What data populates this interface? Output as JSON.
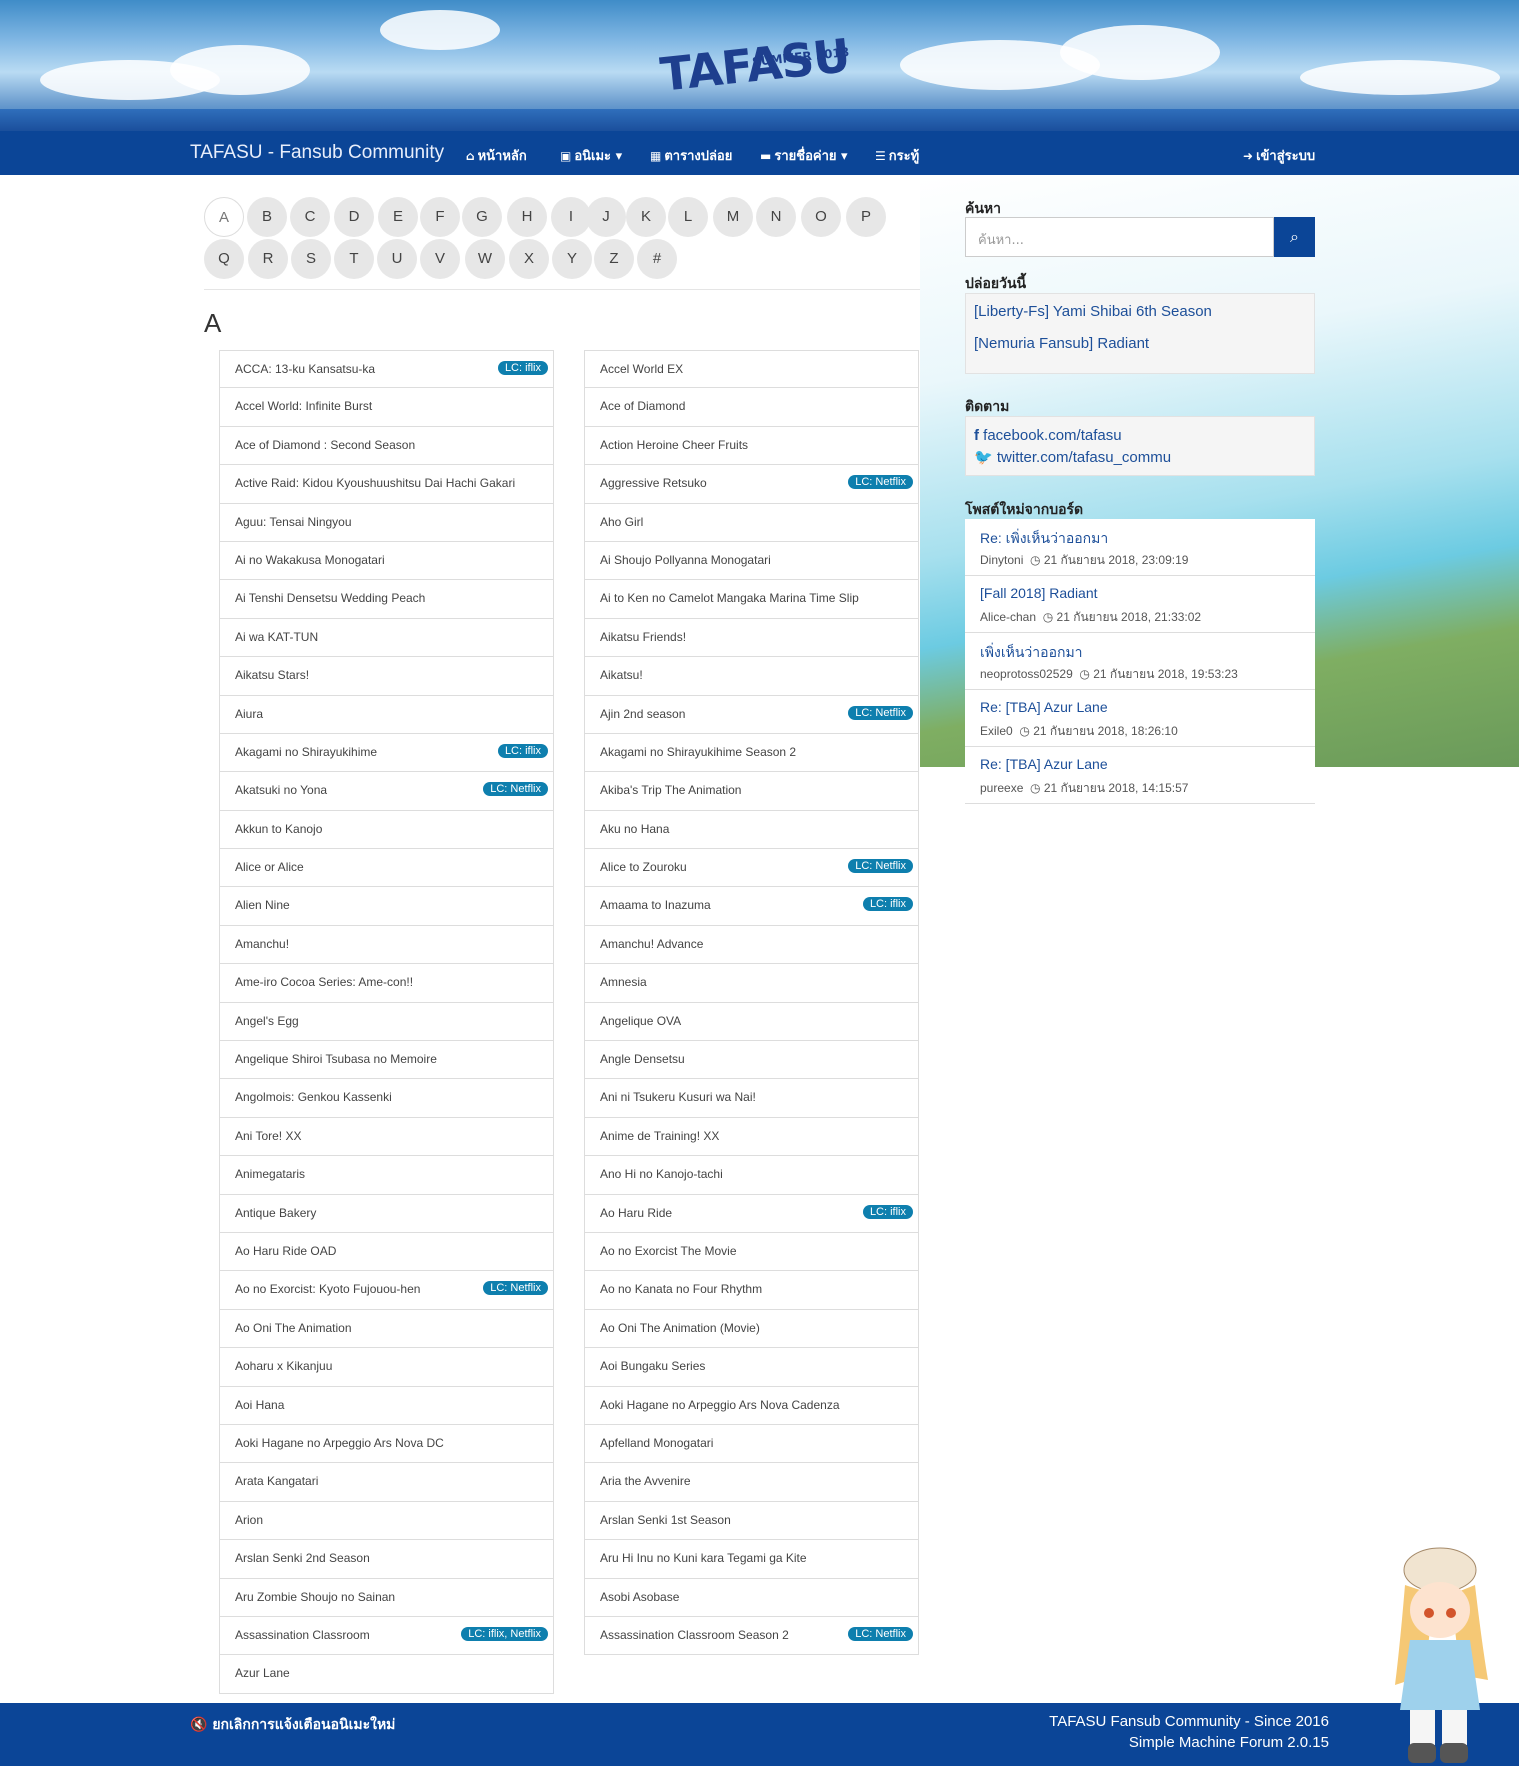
{
  "header": {
    "logo_text": "TAFASU",
    "logo_sub": "SUMMER 2018"
  },
  "navbar": {
    "brand": "TAFASU - Fansub Community",
    "items": [
      {
        "icon": "home-icon",
        "label": "หน้าหลัก"
      },
      {
        "icon": "film-icon",
        "label": "อนิเมะ"
      },
      {
        "icon": "calendar-icon",
        "label": "ตารางปล่อย"
      },
      {
        "icon": "folder-icon",
        "label": "รายชื่อค่าย"
      },
      {
        "icon": "list-icon",
        "label": "กระทู้"
      }
    ],
    "login": "เข้าสู่ระบบ"
  },
  "alphabet": {
    "row1": [
      "A",
      "B",
      "C",
      "D",
      "E",
      "F",
      "G",
      "H",
      "I",
      "J",
      "K",
      "L",
      "M",
      "N",
      "O",
      "P"
    ],
    "row2": [
      "Q",
      "R",
      "S",
      "T",
      "U",
      "V",
      "W",
      "X",
      "Y",
      "Z",
      "#"
    ],
    "active": "A"
  },
  "section_letter": "A",
  "left_list": [
    {
      "title": "ACCA: 13-ku Kansatsu-ka",
      "badge": "LC: iflix"
    },
    {
      "title": "Accel World: Infinite Burst",
      "badge": ""
    },
    {
      "title": "Ace of Diamond : Second Season",
      "badge": ""
    },
    {
      "title": "Active Raid: Kidou Kyoushuushitsu Dai Hachi Gakari",
      "badge": ""
    },
    {
      "title": "Aguu: Tensai Ningyou",
      "badge": ""
    },
    {
      "title": "Ai no Wakakusa Monogatari",
      "badge": ""
    },
    {
      "title": "Ai Tenshi Densetsu Wedding Peach",
      "badge": ""
    },
    {
      "title": "Ai wa KAT-TUN",
      "badge": ""
    },
    {
      "title": "Aikatsu Stars!",
      "badge": ""
    },
    {
      "title": "Aiura",
      "badge": ""
    },
    {
      "title": "Akagami no Shirayukihime",
      "badge": "LC: iflix"
    },
    {
      "title": "Akatsuki no Yona",
      "badge": "LC: Netflix"
    },
    {
      "title": "Akkun to Kanojo",
      "badge": ""
    },
    {
      "title": "Alice or Alice",
      "badge": ""
    },
    {
      "title": "Alien Nine",
      "badge": ""
    },
    {
      "title": "Amanchu!",
      "badge": ""
    },
    {
      "title": "Ame-iro Cocoa Series: Ame-con!!",
      "badge": ""
    },
    {
      "title": "Angel's Egg",
      "badge": ""
    },
    {
      "title": "Angelique Shiroi Tsubasa no Memoire",
      "badge": ""
    },
    {
      "title": "Angolmois: Genkou Kassenki",
      "badge": ""
    },
    {
      "title": "Ani Tore! XX",
      "badge": ""
    },
    {
      "title": "Animegataris",
      "badge": ""
    },
    {
      "title": "Antique Bakery",
      "badge": ""
    },
    {
      "title": "Ao Haru Ride OAD",
      "badge": ""
    },
    {
      "title": "Ao no Exorcist: Kyoto Fujouou-hen",
      "badge": "LC: Netflix"
    },
    {
      "title": "Ao Oni The Animation",
      "badge": ""
    },
    {
      "title": "Aoharu x Kikanjuu",
      "badge": ""
    },
    {
      "title": "Aoi Hana",
      "badge": ""
    },
    {
      "title": "Aoki Hagane no Arpeggio Ars Nova DC",
      "badge": ""
    },
    {
      "title": "Arata Kangatari",
      "badge": ""
    },
    {
      "title": "Arion",
      "badge": ""
    },
    {
      "title": "Arslan Senki 2nd Season",
      "badge": ""
    },
    {
      "title": "Aru Zombie Shoujo no Sainan",
      "badge": ""
    },
    {
      "title": "Assassination Classroom",
      "badge": "LC: iflix, Netflix"
    },
    {
      "title": "Azur Lane",
      "badge": ""
    }
  ],
  "right_list": [
    {
      "title": "Accel World EX",
      "badge": ""
    },
    {
      "title": "Ace of Diamond",
      "badge": ""
    },
    {
      "title": "Action Heroine Cheer Fruits",
      "badge": ""
    },
    {
      "title": "Aggressive Retsuko",
      "badge": "LC: Netflix"
    },
    {
      "title": "Aho Girl",
      "badge": ""
    },
    {
      "title": "Ai Shoujo Pollyanna Monogatari",
      "badge": ""
    },
    {
      "title": "Ai to Ken no Camelot Mangaka Marina Time Slip",
      "badge": ""
    },
    {
      "title": "Aikatsu Friends!",
      "badge": ""
    },
    {
      "title": "Aikatsu!",
      "badge": ""
    },
    {
      "title": "Ajin 2nd season",
      "badge": "LC: Netflix"
    },
    {
      "title": "Akagami no Shirayukihime Season 2",
      "badge": ""
    },
    {
      "title": "Akiba's Trip The Animation",
      "badge": ""
    },
    {
      "title": "Aku no Hana",
      "badge": ""
    },
    {
      "title": "Alice to Zouroku",
      "badge": "LC: Netflix"
    },
    {
      "title": "Amaama to Inazuma",
      "badge": "LC: iflix"
    },
    {
      "title": "Amanchu! Advance",
      "badge": ""
    },
    {
      "title": "Amnesia",
      "badge": ""
    },
    {
      "title": "Angelique OVA",
      "badge": ""
    },
    {
      "title": "Angle Densetsu",
      "badge": ""
    },
    {
      "title": "Ani ni Tsukeru Kusuri wa Nai!",
      "badge": ""
    },
    {
      "title": "Anime de Training! XX",
      "badge": ""
    },
    {
      "title": "Ano Hi no Kanojo-tachi",
      "badge": ""
    },
    {
      "title": "Ao Haru Ride",
      "badge": "LC: iflix"
    },
    {
      "title": "Ao no Exorcist The Movie",
      "badge": ""
    },
    {
      "title": "Ao no Kanata no Four Rhythm",
      "badge": ""
    },
    {
      "title": "Ao Oni The Animation (Movie)",
      "badge": ""
    },
    {
      "title": "Aoi Bungaku Series",
      "badge": ""
    },
    {
      "title": "Aoki Hagane no Arpeggio Ars Nova Cadenza",
      "badge": ""
    },
    {
      "title": "Apfelland Monogatari",
      "badge": ""
    },
    {
      "title": "Aria the Avvenire",
      "badge": ""
    },
    {
      "title": "Arslan Senki 1st Season",
      "badge": ""
    },
    {
      "title": "Aru Hi Inu no Kuni kara Tegami ga Kite",
      "badge": ""
    },
    {
      "title": "Asobi Asobase",
      "badge": ""
    },
    {
      "title": "Assassination Classroom Season 2",
      "badge": "LC: Netflix"
    }
  ],
  "sidebar": {
    "search_title": "ค้นหา",
    "search_placeholder": "ค้นหา...",
    "today_title": "ปล่อยวันนี้",
    "today_items": [
      "[Liberty-Fs] Yami Shibai 6th Season",
      "[Nemuria Fansub] Radiant"
    ],
    "follow_title": "ติดตาม",
    "facebook": "facebook.com/tafasu",
    "twitter": "twitter.com/tafasu_commu",
    "posts_title": "โพสต์ใหม่จากบอร์ด",
    "posts": [
      {
        "title": "Re: เพิ่งเห็นว่าออกมา",
        "user": "Dinytoni",
        "time": "21 กันยายน 2018, 23:09:19"
      },
      {
        "title": "[Fall 2018] Radiant",
        "user": "Alice-chan",
        "time": "21 กันยายน 2018, 21:33:02"
      },
      {
        "title": "เพิ่งเห็นว่าออกมา",
        "user": "neoprotoss02529",
        "time": "21 กันยายน 2018, 19:53:23"
      },
      {
        "title": "Re: [TBA] Azur Lane",
        "user": "Exile0",
        "time": "21 กันยายน 2018, 18:26:10"
      },
      {
        "title": "Re: [TBA] Azur Lane",
        "user": "pureexe",
        "time": "21 กันยายน 2018, 14:15:57"
      }
    ]
  },
  "footer": {
    "mute": "ยกเลิกการแจ้งเตือนอนิเมะใหม่",
    "line1": "TAFASU Fansub Community - Since 2016",
    "line2": "Simple Machine Forum 2.0.15"
  },
  "colors": {
    "nav": "#0b4597",
    "badge": "#0e7fae",
    "link": "#1d4f99"
  }
}
